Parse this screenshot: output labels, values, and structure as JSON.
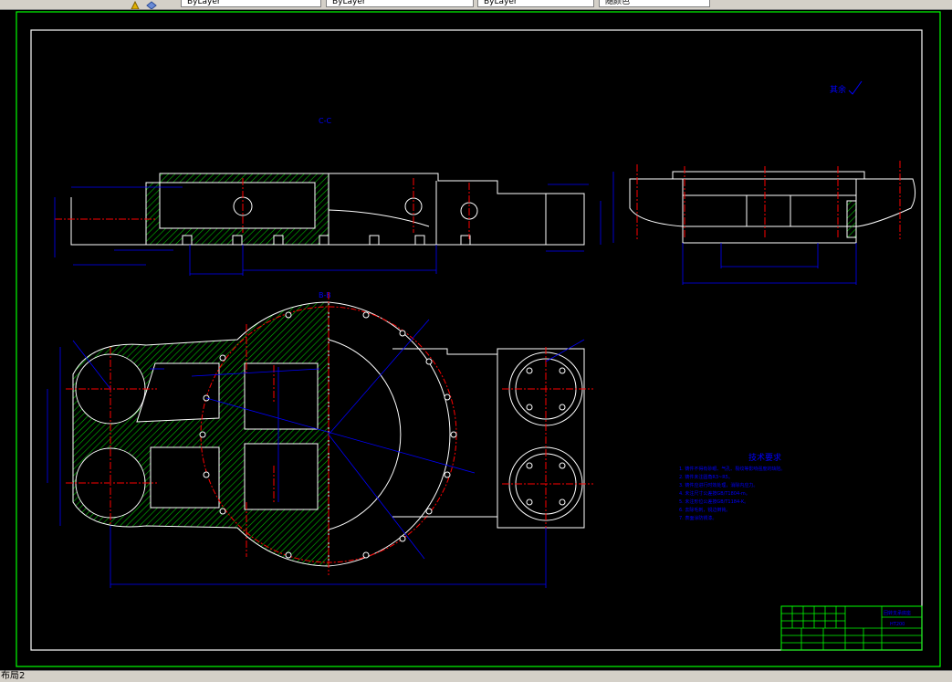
{
  "toolbar": {
    "layer_select": "ByLayer",
    "linetype_select": "ByLayer",
    "lineweight_select": "ByLayer",
    "plotstyle_select": "随颜色"
  },
  "drawing": {
    "section_cc": "C-C",
    "section_bb": "B-B",
    "roughness_note": "其余",
    "tech_title": "技术要求",
    "tech_items": [
      "1. 铸件不得有砂眼、气孔、裂纹等影响强度的缺陷。",
      "2. 铸件未注圆角R3~R5。",
      "3. 铸件应进行时效处理，消除内应力。",
      "4. 未注尺寸公差按GB/T1804-m。",
      "5. 未注形位公差按GB/T1184-K。",
      "6. 去除毛刺，锐边倒钝。",
      "7. 表面涂防锈漆。"
    ],
    "title_block": {
      "name": "回转支承底座",
      "material": "HT200"
    }
  },
  "layout_tabs": {
    "active": "布局2"
  },
  "colors": {
    "background": "#000000",
    "outline": "#ffffff",
    "dimension": "#0000ff",
    "centerline": "#ff0000",
    "hatch": "#00c000",
    "border": "#00ff00"
  }
}
